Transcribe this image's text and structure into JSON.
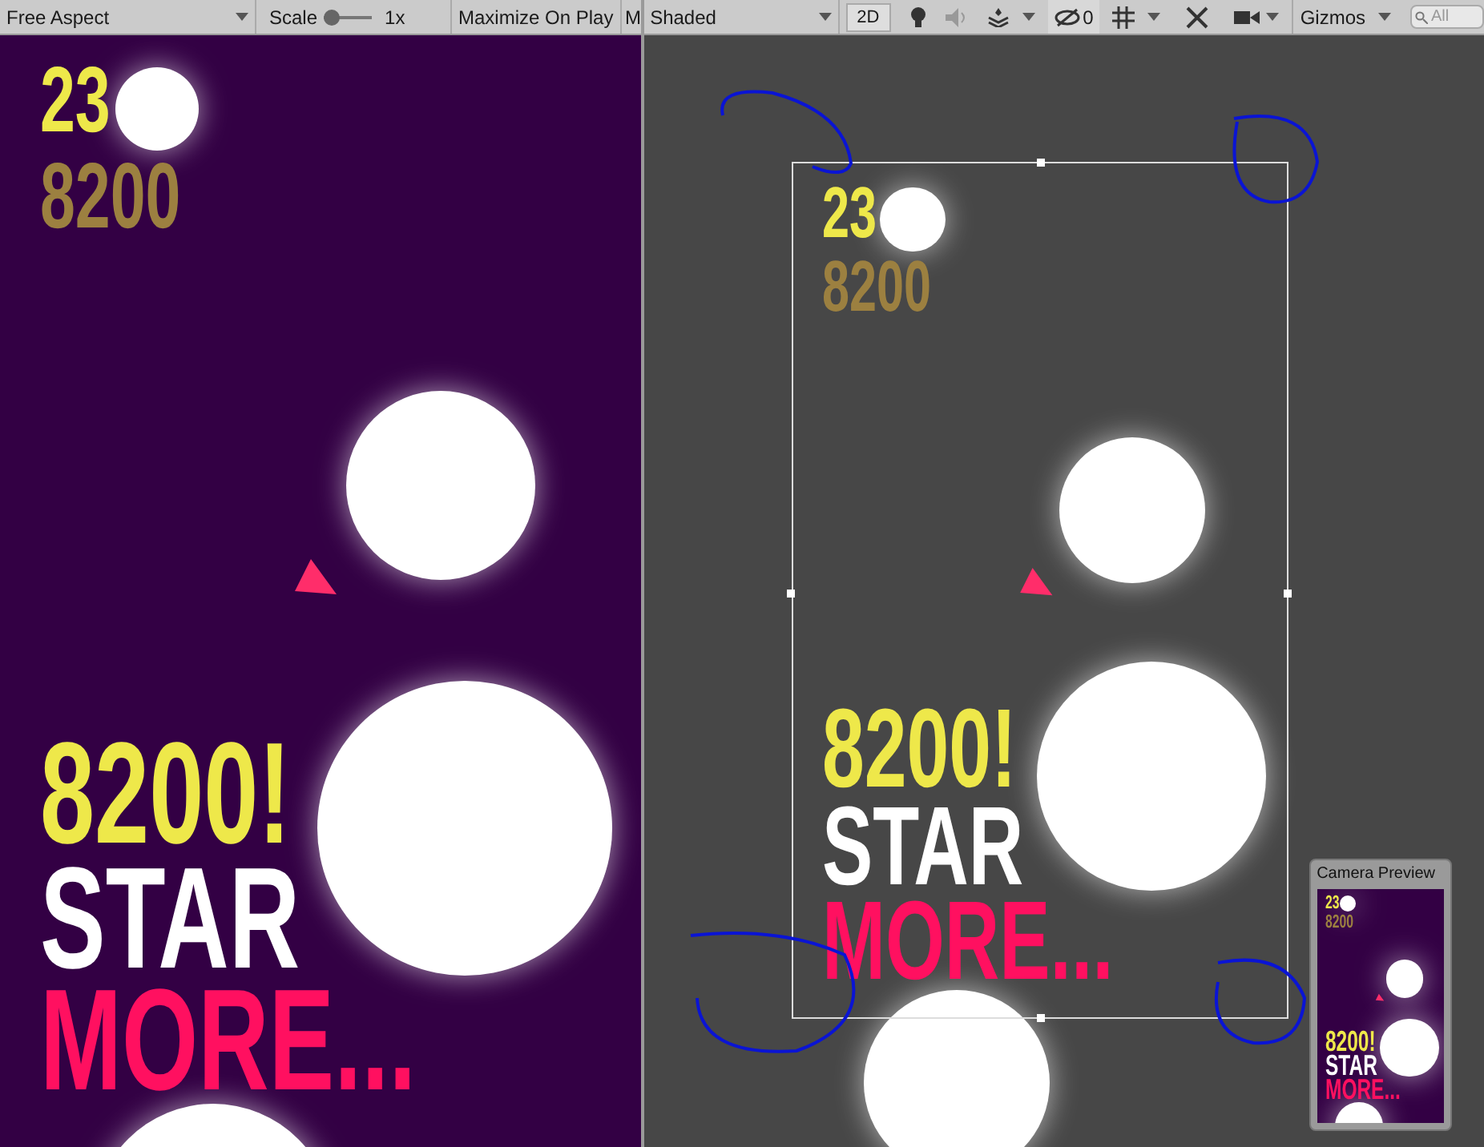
{
  "game_toolbar": {
    "aspect": "Free Aspect",
    "scale_label": "Scale",
    "scale_value": "1x",
    "scale_slider": {
      "level": 0
    },
    "maximize": "Maximize On Play",
    "cut_label": "M"
  },
  "scene_toolbar": {
    "shading": "Shaded",
    "mode_2d": {
      "label": "2D",
      "selected": true
    },
    "hidden_count": "0",
    "gizmos": "Gizmos",
    "search_placeholder": "All"
  },
  "game_view": {
    "level": "23",
    "best": "8200",
    "score": "8200!",
    "start": "STAR",
    "more": "MORE..."
  },
  "scene_view": {
    "level": "23",
    "best": "8200",
    "score": "8200!",
    "start": "STAR",
    "more": "MORE..."
  },
  "camera_preview": {
    "title": "Camera Preview",
    "level": "23",
    "best": "8200",
    "score": "8200!",
    "start": "STAR",
    "more": "MORE..."
  }
}
